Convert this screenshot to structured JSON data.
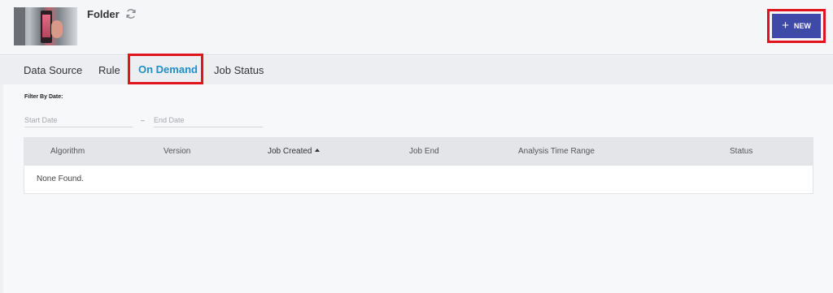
{
  "header": {
    "folder_title": "Folder",
    "refresh_icon": "refresh-icon",
    "new_button_label": "NEW",
    "new_button_icon": "plus-icon",
    "accent_color": "#3f4aa8",
    "highlight_color": "#e0141f"
  },
  "tabs": [
    {
      "label": "Data Source"
    },
    {
      "label": "Rule"
    },
    {
      "label": "On Demand",
      "active": true
    },
    {
      "label": "Job Status"
    }
  ],
  "filter": {
    "label": "Filter By Date:",
    "start_placeholder": "Start Date",
    "separator": "–",
    "end_placeholder": "End Date"
  },
  "table": {
    "columns": [
      {
        "label": "Algorithm"
      },
      {
        "label": "Version"
      },
      {
        "label": "Job Created",
        "sorted": "ascending"
      },
      {
        "label": "Job End"
      },
      {
        "label": "Analysis Time Range"
      },
      {
        "label": "Status"
      }
    ],
    "empty_message": "None Found."
  }
}
